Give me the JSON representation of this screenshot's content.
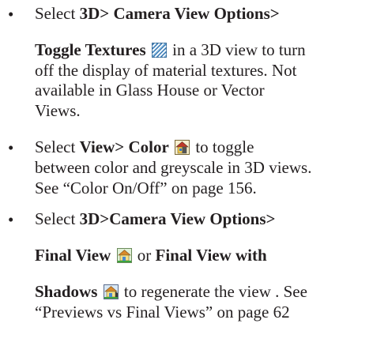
{
  "items": [
    {
      "lines": [
        {
          "t1": "Select ",
          "b1": "3D> Camera View Options>"
        },
        {
          "b1": "Toggle Textures",
          "icon": "toggle-textures-icon",
          "t2": " in a 3D view to turn"
        },
        {
          "t1": "off the display of material textures. Not"
        },
        {
          "t1": "available in Glass House or Vector"
        },
        {
          "t1": "Views."
        }
      ]
    },
    {
      "lines": [
        {
          "t1": "Select ",
          "b1": "View> Color",
          "icon": "color-toggle-icon",
          "t2": " to toggle"
        },
        {
          "t1": "between color and greyscale in 3D views."
        },
        {
          "t1": "See “Color On/Off” on page 156."
        }
      ]
    },
    {
      "lines": [
        {
          "t1": "Select ",
          "b1": "3D>Camera View Options>"
        },
        {
          "b1": "Final View",
          "icon": "final-view-icon",
          "t2": " or ",
          "b2": "Final View with"
        },
        {
          "b1": "Shadows",
          "icon": "final-view-shadows-icon",
          "t2": " to regenerate the view . See"
        },
        {
          "t1": "“Previews vs Final Views” on page 62"
        }
      ]
    }
  ],
  "colors": {
    "text": "#231f20",
    "bullet": "#231f20"
  }
}
